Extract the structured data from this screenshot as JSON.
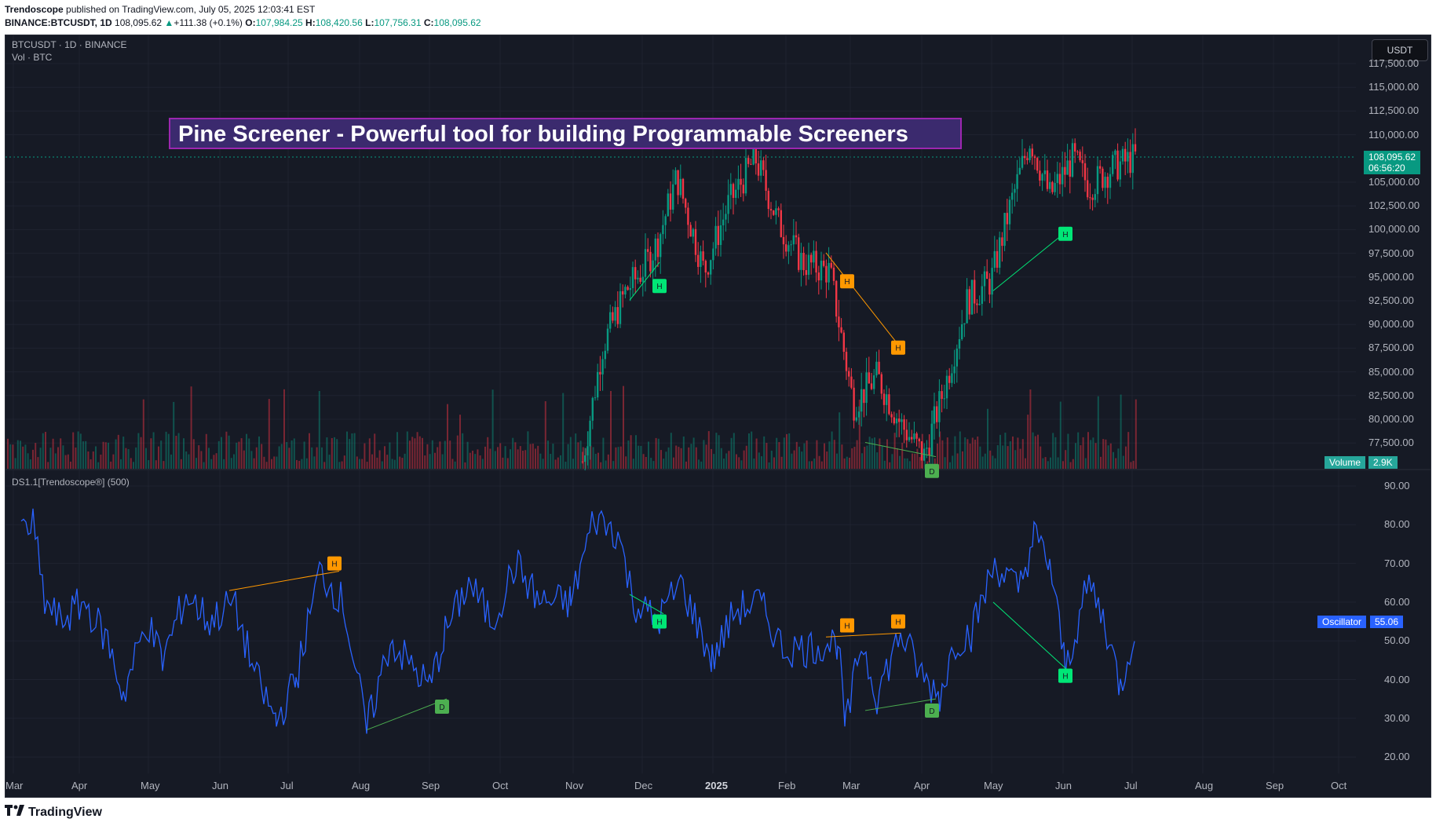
{
  "publish_line": {
    "author": "Trendoscope",
    "text": " published on TradingView.com, July 05, 2025 12:03:41 EST"
  },
  "symbol_line": {
    "symbol": "BINANCE:BTCUSDT, 1D",
    "price": "108,095.62",
    "arrow": "▲",
    "change": "+111.38 (+0.1%)",
    "o_label": "O:",
    "o": "107,984.25",
    "h_label": "H:",
    "h": "108,420.56",
    "l_label": "L:",
    "l": "107,756.31",
    "c_label": "C:",
    "c": "108,095.62"
  },
  "chart": {
    "legend_main": "BTCUSDT · 1D · BINANCE",
    "legend_vol": "Vol · BTC",
    "indicator_label": "DS1.1[Trendoscope®] (500)",
    "banner": "Pine Screener - Powerful tool for building Programmable Screeners",
    "currency_button": "USDT",
    "price_axis": [
      "117,500.00",
      "115,000.00",
      "112,500.00",
      "110,000.00",
      "105,000.00",
      "102,500.00",
      "100,000.00",
      "97,500.00",
      "95,000.00",
      "92,500.00",
      "90,000.00",
      "87,500.00",
      "85,000.00",
      "82,500.00",
      "80,000.00",
      "77,500.00"
    ],
    "osc_axis": [
      "90.00",
      "80.00",
      "70.00",
      "60.00",
      "50.00",
      "40.00",
      "30.00",
      "20.00"
    ],
    "time_axis": [
      "Mar",
      "Apr",
      "May",
      "Jun",
      "Jul",
      "Aug",
      "Sep",
      "Oct",
      "Nov",
      "Dec",
      "2025",
      "Feb",
      "Mar",
      "Apr",
      "May",
      "Jun",
      "Jul",
      "Aug",
      "Sep",
      "Oct"
    ],
    "price_tag": {
      "value": "108,095.62",
      "countdown": "06:56:20",
      "color": "#089981"
    },
    "volume_tag": {
      "label": "Volume",
      "value": "2.9K",
      "color": "#26a69a"
    },
    "osc_tag": {
      "label": "Oscillator",
      "value": "55.06",
      "color": "#2962ff"
    },
    "markers": [
      "H",
      "H",
      "H",
      "H",
      "H",
      "D",
      "H",
      "D",
      "H",
      "H",
      "H",
      "H",
      "D",
      "H"
    ],
    "colors": {
      "bull": "#089981",
      "bear": "#f23645",
      "osc_line": "#2962ff",
      "bearish_div": "#ff9800",
      "bullish_div": "#00e676",
      "hidden_bull": "#4caf50"
    }
  },
  "footer": {
    "logo_icon": "tradingview-logo-icon",
    "logo_text": "TradingView"
  }
}
